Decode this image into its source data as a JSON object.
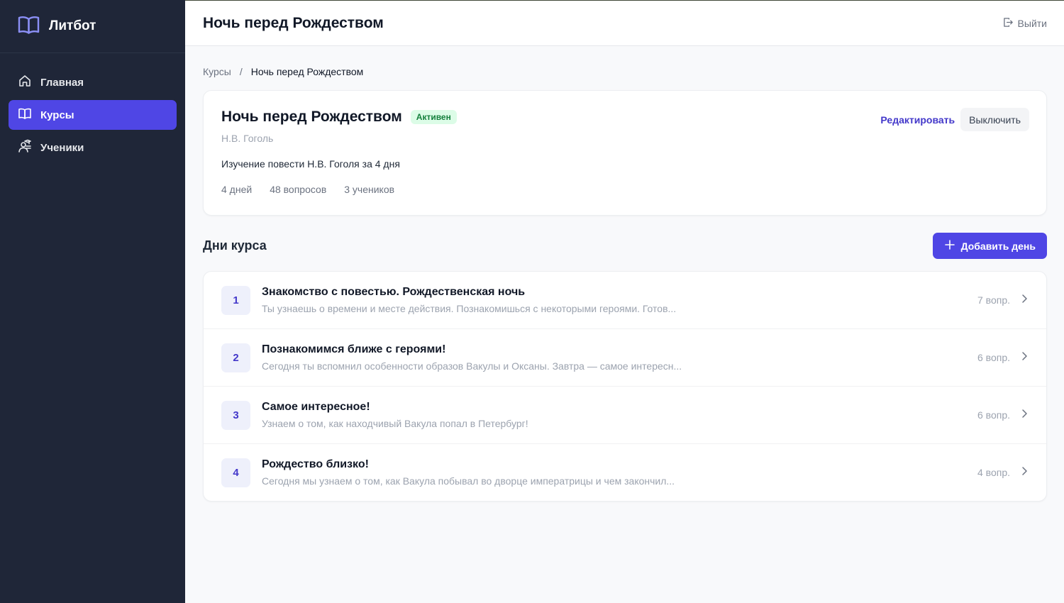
{
  "app": {
    "name": "Литбот",
    "brand_color": "#4f46e5",
    "sidebar_bg": "#1f2638"
  },
  "sidebar": {
    "items": [
      {
        "label": "Главная",
        "icon": "home-icon",
        "active": false
      },
      {
        "label": "Курсы",
        "icon": "book-icon",
        "active": true
      },
      {
        "label": "Ученики",
        "icon": "students-icon",
        "active": false
      }
    ]
  },
  "header": {
    "title": "Ночь перед Рождеством",
    "logout_label": "Выйти"
  },
  "breadcrumb": {
    "parent": "Курсы",
    "separator": "/",
    "current": "Ночь перед Рождеством"
  },
  "course": {
    "title": "Ночь перед Рождеством",
    "status": "Активен",
    "author": "Н.В. Гоголь",
    "description": "Изучение повести Н.В. Гоголя за 4 дня",
    "stats": {
      "days": "4 дней",
      "questions": "48 вопросов",
      "students": "3 учеников"
    },
    "edit_label": "Редактировать",
    "disable_label": "Выключить"
  },
  "days_section": {
    "title": "Дни курса",
    "add_label": "Добавить день",
    "days": [
      {
        "number": "1",
        "title": "Знакомство с повестью. Рождественская ночь",
        "subtitle": "Ты узнаешь о времени и месте действия. Познакомишься с некоторыми героями. Готов...",
        "count": "7 вопр."
      },
      {
        "number": "2",
        "title": "Познакомимся ближе с героями!",
        "subtitle": "Сегодня ты вспомнил особенности образов Вакулы и Оксаны. Завтра — самое интересн...",
        "count": "6 вопр."
      },
      {
        "number": "3",
        "title": "Самое интересное!",
        "subtitle": "Узнаем о том, как находчивый Вакула попал в Петербург!",
        "count": "6 вопр."
      },
      {
        "number": "4",
        "title": "Рождество близко!",
        "subtitle": "Сегодня мы узнаем о том, как Вакула побывал во дворце императрицы и чем закончил...",
        "count": "4 вопр."
      }
    ]
  }
}
